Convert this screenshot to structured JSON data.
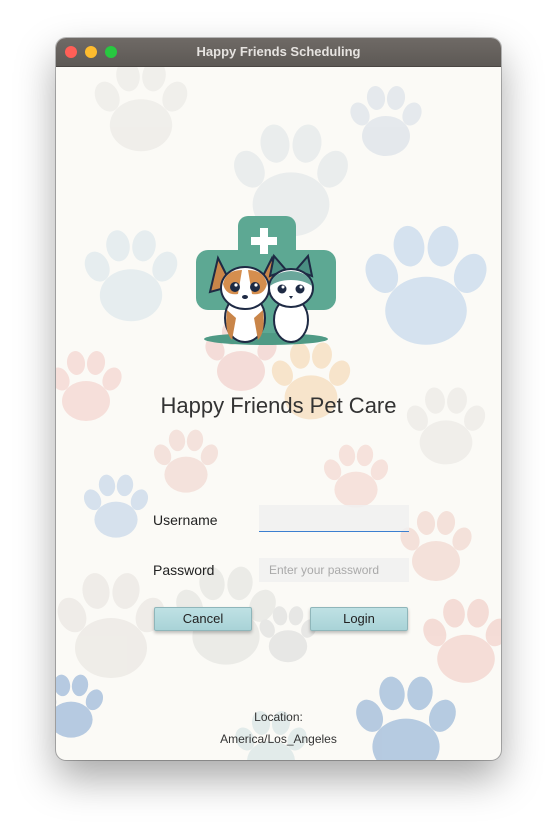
{
  "window": {
    "title": "Happy Friends Scheduling"
  },
  "app": {
    "title": "Happy Friends Pet Care"
  },
  "form": {
    "username_label": "Username",
    "username_value": "",
    "password_label": "Password",
    "password_placeholder": "Enter your password",
    "cancel_label": "Cancel",
    "login_label": "Login"
  },
  "location": {
    "label": "Location:",
    "zone": "America/Los_Angeles"
  },
  "icons": {
    "logo": "pet-care-logo-icon",
    "background": "paw-print-icon"
  },
  "colors": {
    "button": "#b3dadd",
    "logo_green": "#5da893",
    "focus": "#3b7fd0"
  }
}
